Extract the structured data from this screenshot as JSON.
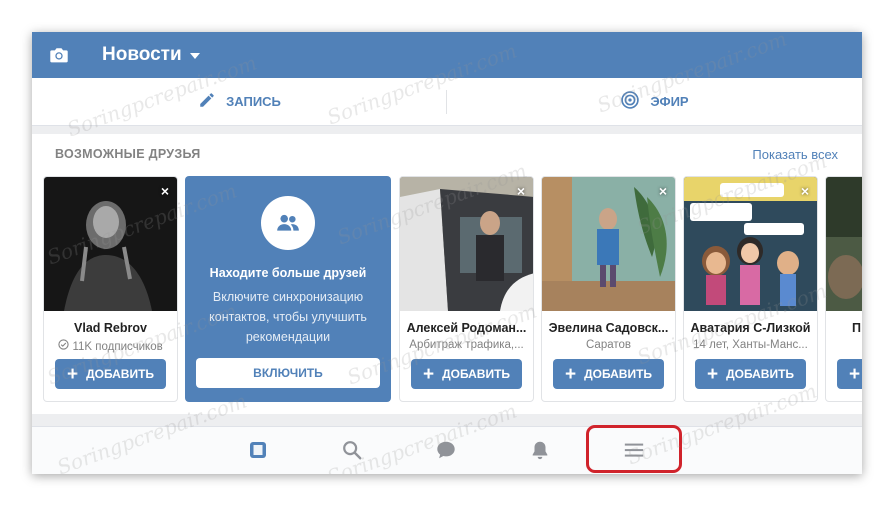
{
  "header": {
    "title": "Новости",
    "camera_icon": "camera-icon",
    "dropdown_icon": "chevron-down-icon"
  },
  "actions": [
    {
      "label": "ЗАПИСЬ",
      "icon": "pencil-icon"
    },
    {
      "label": "ЭФИР",
      "icon": "live-broadcast-icon"
    }
  ],
  "friends": {
    "heading": "ВОЗМОЖНЫЕ ДРУЗЬЯ",
    "show_all": "Показать всех",
    "promo": {
      "title": "Находите больше друзей",
      "text": "Включите синхронизацию контактов, чтобы улучшить рекомендации",
      "button": "ВКЛЮЧИТЬ",
      "icon": "users-icon"
    },
    "add_label": "ДОБАВИТЬ",
    "close_glyph": "×",
    "cards": [
      {
        "name": "Vlad Rebrov",
        "sub": "11K подписчиков",
        "verified_icon": "badge-icon"
      },
      {
        "name": "Алексей Родоман...",
        "sub": "Арбитраж трафика,..."
      },
      {
        "name": "Эвелина Садовск...",
        "sub": "Саратов"
      },
      {
        "name": "Аватария С-Лизкой",
        "sub": "14 лет, Ханты-Манс..."
      },
      {
        "name": "П",
        "sub": ""
      }
    ]
  },
  "bottom_nav": [
    {
      "name": "news-icon"
    },
    {
      "name": "search-icon"
    },
    {
      "name": "messages-icon"
    },
    {
      "name": "notifications-icon"
    },
    {
      "name": "menu-icon"
    }
  ],
  "watermark": "Soringpcrepair.com",
  "colors": {
    "brand": "#5181b8",
    "background": "#edeef0",
    "highlight": "#d0232b"
  }
}
